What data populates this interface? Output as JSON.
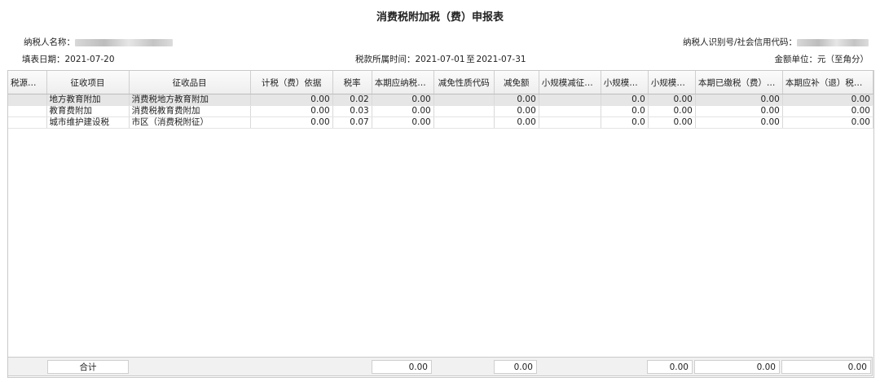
{
  "title": "消费税附加税（费）申报表",
  "info": {
    "taxpayer_name_label": "纳税人名称：",
    "taxpayer_id_label": "纳税人识别号/社会信用代码：",
    "fill_date_label": "填表日期：",
    "fill_date": "2021-07-20",
    "period_label": "税款所属时间：",
    "period_start": "2021-07-01",
    "period_to": "至",
    "period_end": "2021-07-31",
    "unit": "金额单位：元（至角分）"
  },
  "table": {
    "columns": [
      "税源编号",
      "征收项目",
      "征收品目",
      "计税（费）依据",
      "税率",
      "本期应纳税（…",
      "减免性质代码",
      "减免额",
      "小规模减征减…",
      "小规模减…",
      "小规模减…",
      "本期已缴税（费）额",
      "本期应补（退）税（费…"
    ],
    "rows": [
      [
        "",
        "地方教育附加",
        "消费税地方教育附加",
        "0.00",
        "0.02",
        "0.00",
        "",
        "0.00",
        "",
        "0.0",
        "0.00",
        "0.00",
        "0.00"
      ],
      [
        "",
        "教育费附加",
        "消费税教育费附加",
        "0.00",
        "0.03",
        "0.00",
        "",
        "0.00",
        "",
        "0.0",
        "0.00",
        "0.00",
        "0.00"
      ],
      [
        "",
        "城市维护建设税",
        "市区（消费税附征）",
        "0.00",
        "0.07",
        "0.00",
        "",
        "0.00",
        "",
        "0.0",
        "0.00",
        "0.00",
        "0.00"
      ]
    ]
  },
  "footer": {
    "total_label": "合计",
    "tax_due_total": "0.00",
    "relief_total": "0.00",
    "small_relief_total": "0.00",
    "paid_total": "0.00",
    "refund_total": "0.00"
  },
  "colors": {
    "required_marker": "#e03030",
    "selected_row": "#e6e6e6",
    "header_bg": "#eeeeee"
  }
}
